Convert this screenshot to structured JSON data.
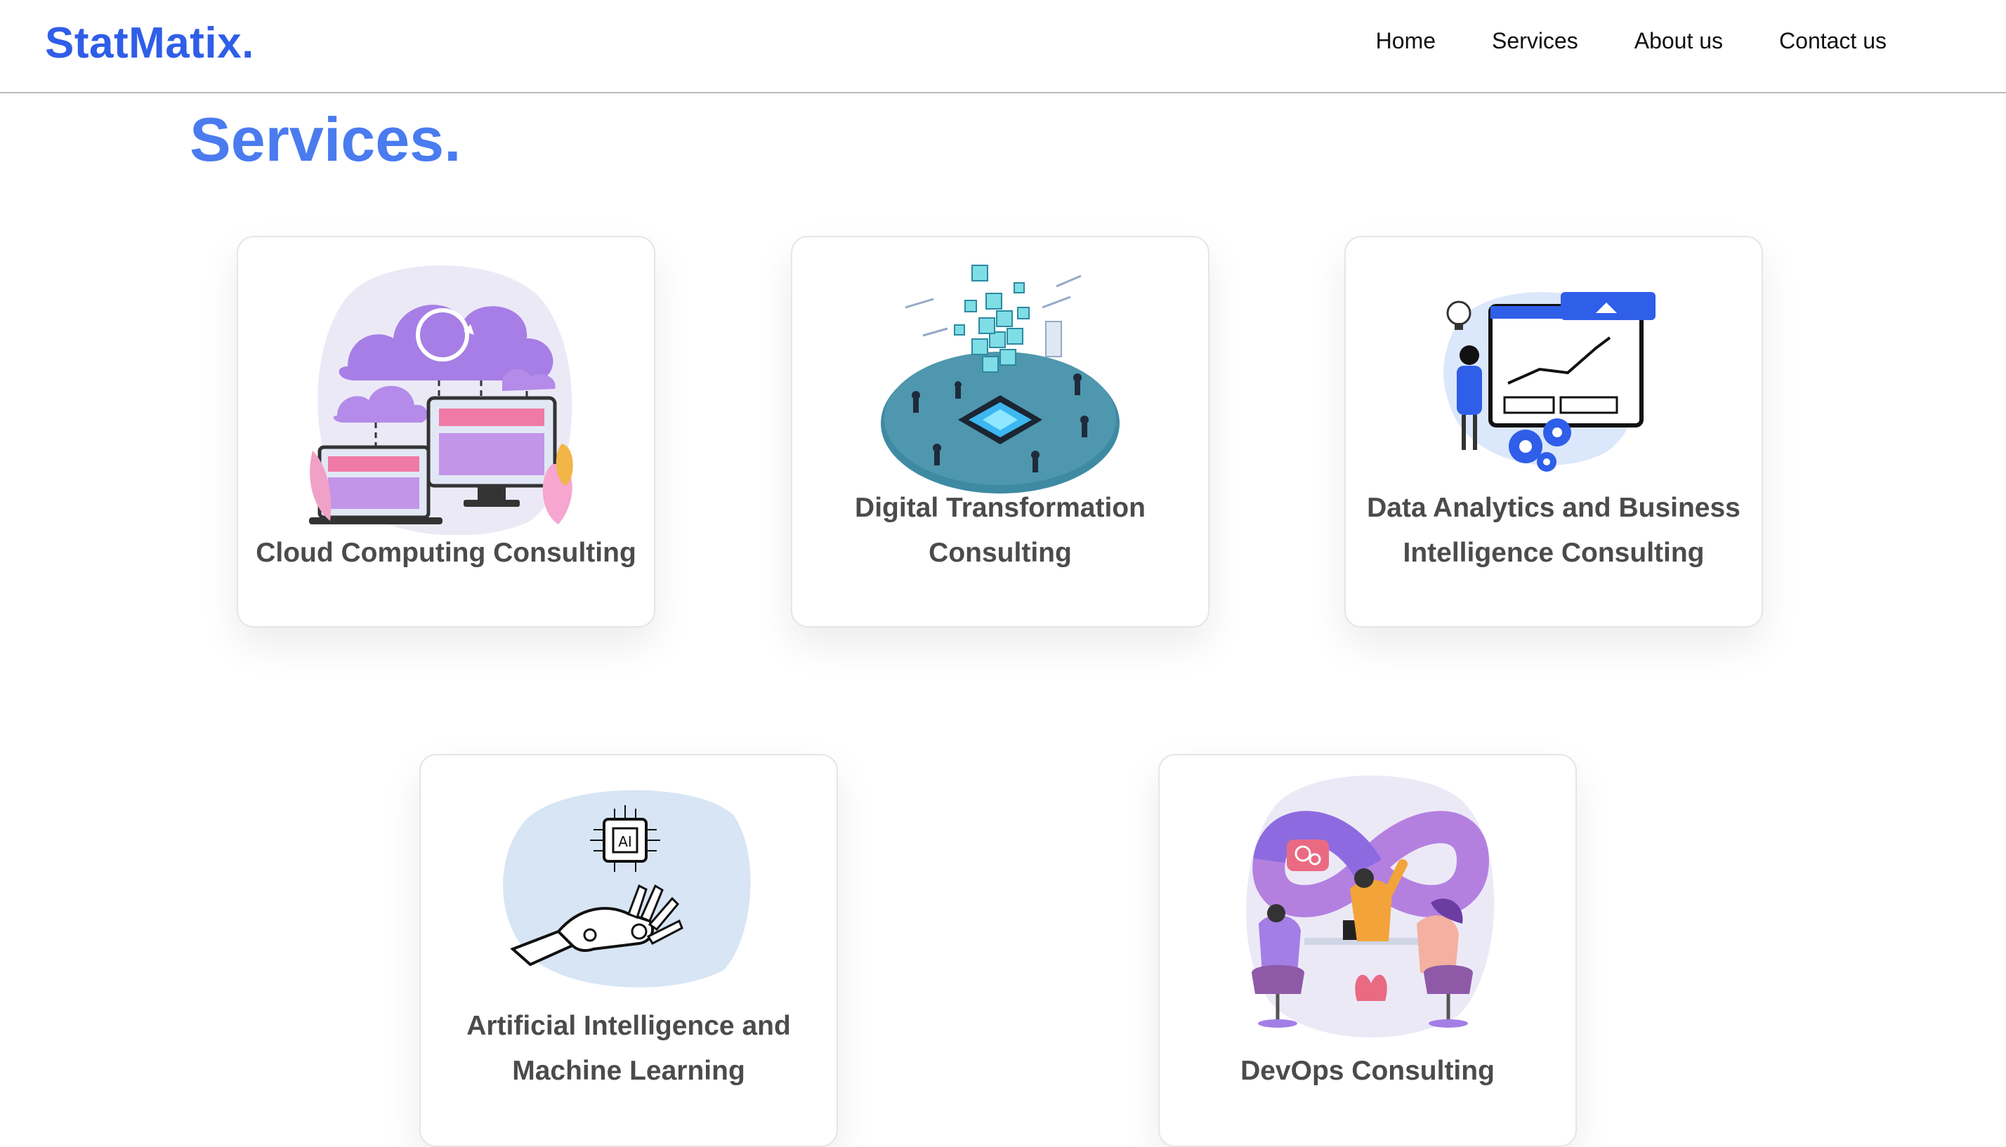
{
  "header": {
    "logo": "StatMatix.",
    "nav": [
      "Home",
      "Services",
      "About us",
      "Contact us"
    ]
  },
  "page": {
    "title": "Services."
  },
  "services": [
    {
      "title": "Cloud Computing Consulting",
      "icon": "cloud-computing-illustration"
    },
    {
      "title": "Digital Transformation Consulting",
      "icon": "digital-transformation-illustration"
    },
    {
      "title": "Data Analytics and Business Intelligence Consulting",
      "icon": "data-analytics-illustration"
    },
    {
      "title": "Artificial Intelligence and Machine Learning",
      "icon": "ai-robot-hand-illustration"
    },
    {
      "title": "DevOps Consulting",
      "icon": "devops-infinity-illustration"
    }
  ],
  "colors": {
    "brand": "#2f5ee8",
    "title": "#4a7bef",
    "card_text": "#4b4b4b"
  }
}
